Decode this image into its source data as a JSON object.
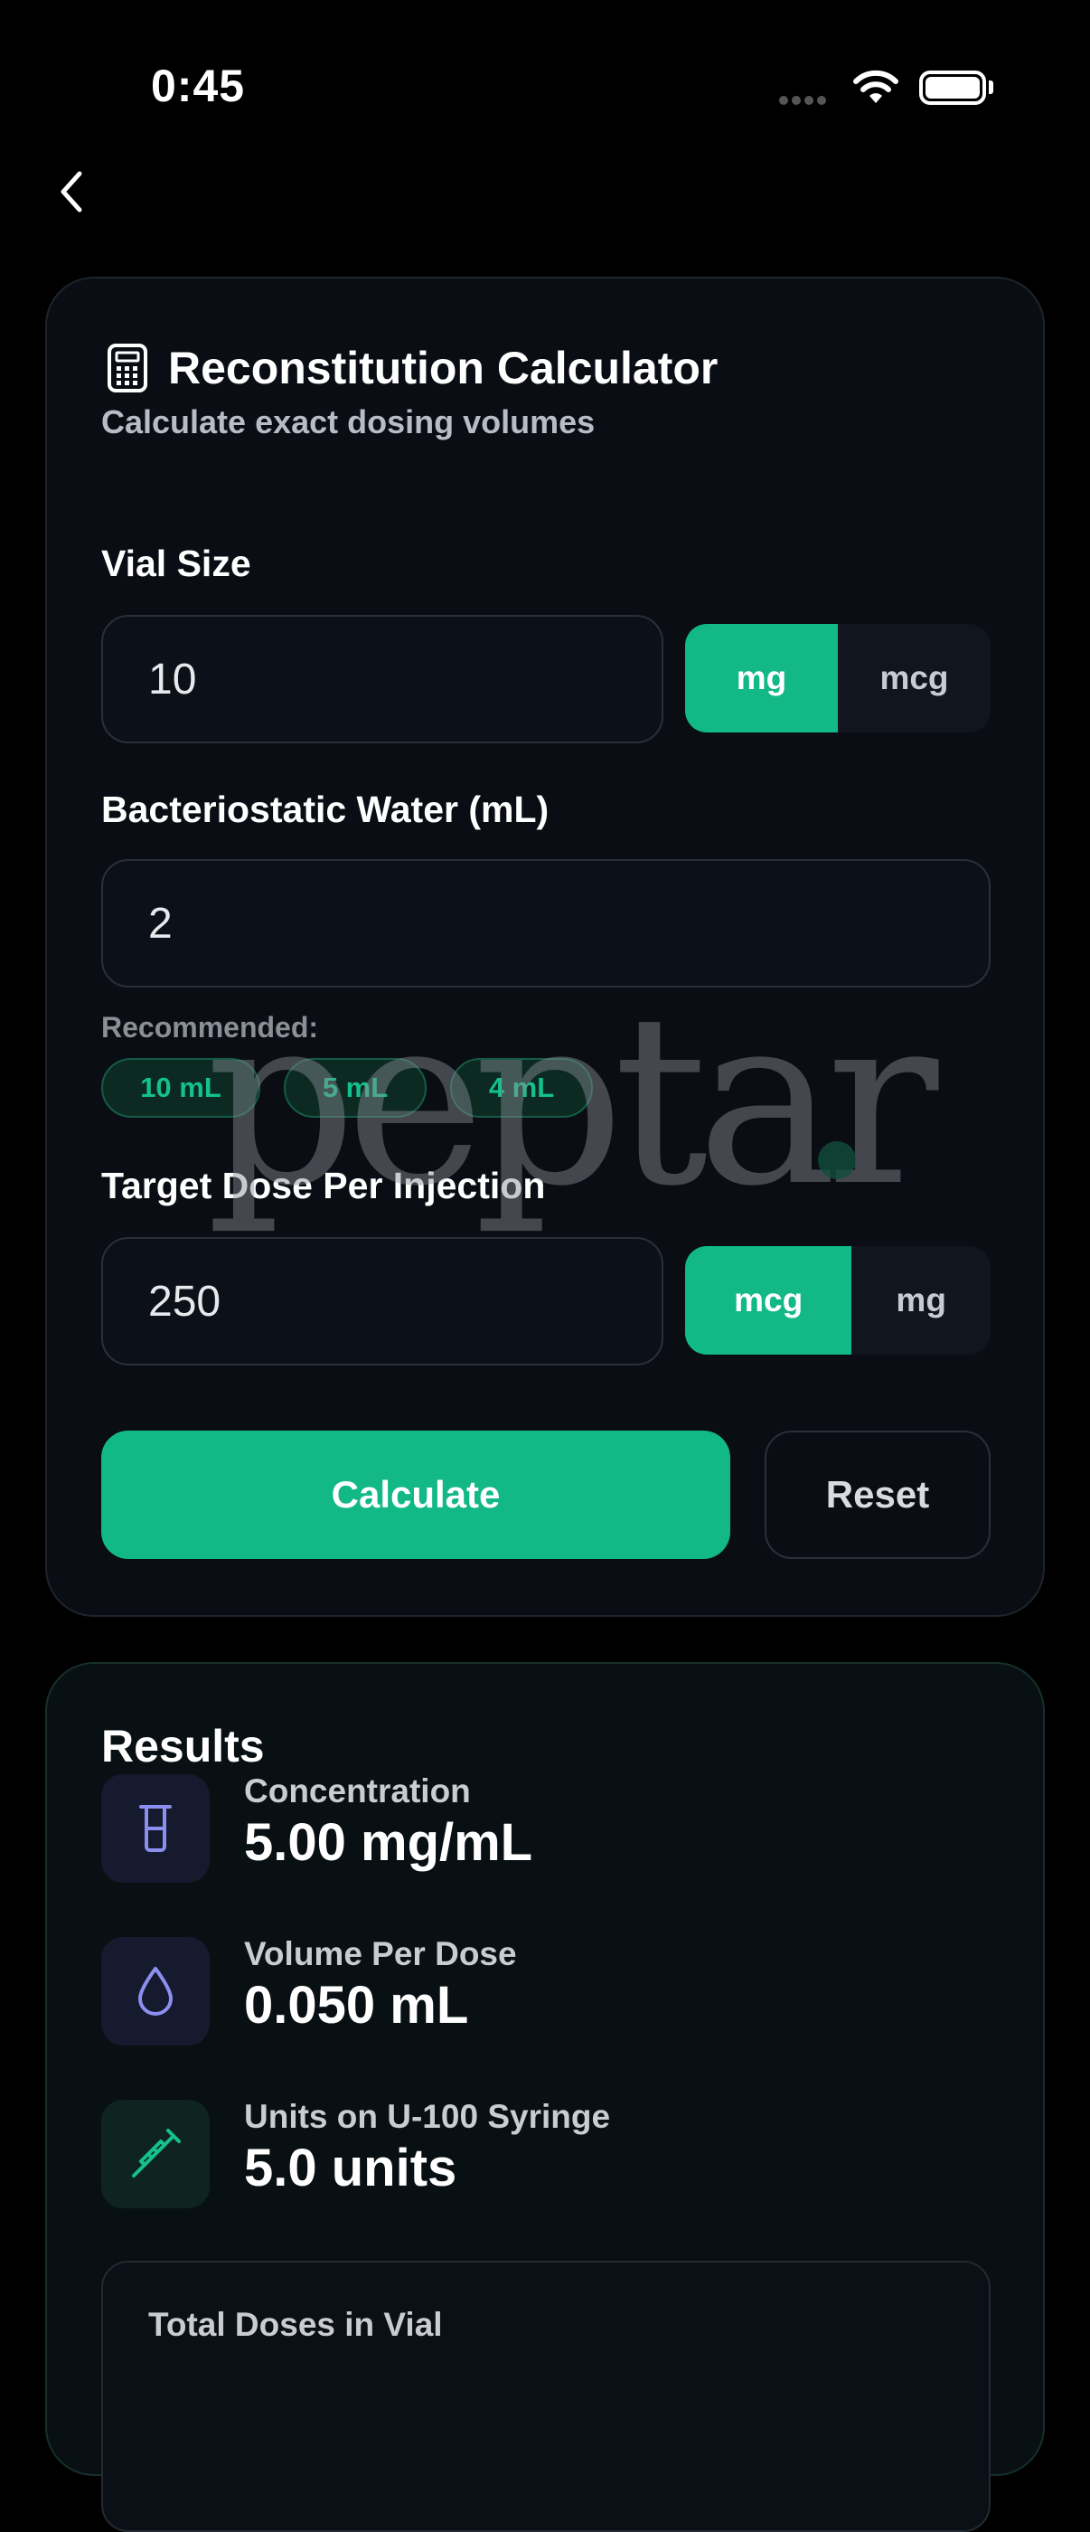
{
  "status": {
    "time": "0:45"
  },
  "calculator": {
    "title": "Reconstitution Calculator",
    "subtitle": "Calculate exact dosing volumes",
    "vial_size": {
      "label": "Vial Size",
      "value": "10",
      "units": [
        "mg",
        "mcg"
      ],
      "selected_unit": "mg"
    },
    "water": {
      "label": "Bacteriostatic Water (mL)",
      "value": "2"
    },
    "recommended": {
      "label": "Recommended:",
      "chips": [
        "10 mL",
        "5 mL",
        "4 mL"
      ]
    },
    "target_dose": {
      "label": "Target Dose Per Injection",
      "value": "250",
      "units": [
        "mcg",
        "mg"
      ],
      "selected_unit": "mcg"
    },
    "calculate_label": "Calculate",
    "reset_label": "Reset"
  },
  "watermark": "peptar",
  "results": {
    "title": "Results",
    "metrics": [
      {
        "label": "Concentration",
        "value": "5.00 mg/mL",
        "icon": "beaker-icon",
        "color": "#8b8ff0"
      },
      {
        "label": "Volume Per Dose",
        "value": "0.050 mL",
        "icon": "droplet-icon",
        "color": "#8b8ff0"
      },
      {
        "label": "Units on U-100 Syringe",
        "value": "5.0 units",
        "icon": "syringe-icon",
        "color": "#14c08d"
      }
    ],
    "total_doses_label": "Total Doses in Vial"
  },
  "colors": {
    "accent": "#12b886",
    "background": "#000000",
    "card": "#0a0d14"
  }
}
